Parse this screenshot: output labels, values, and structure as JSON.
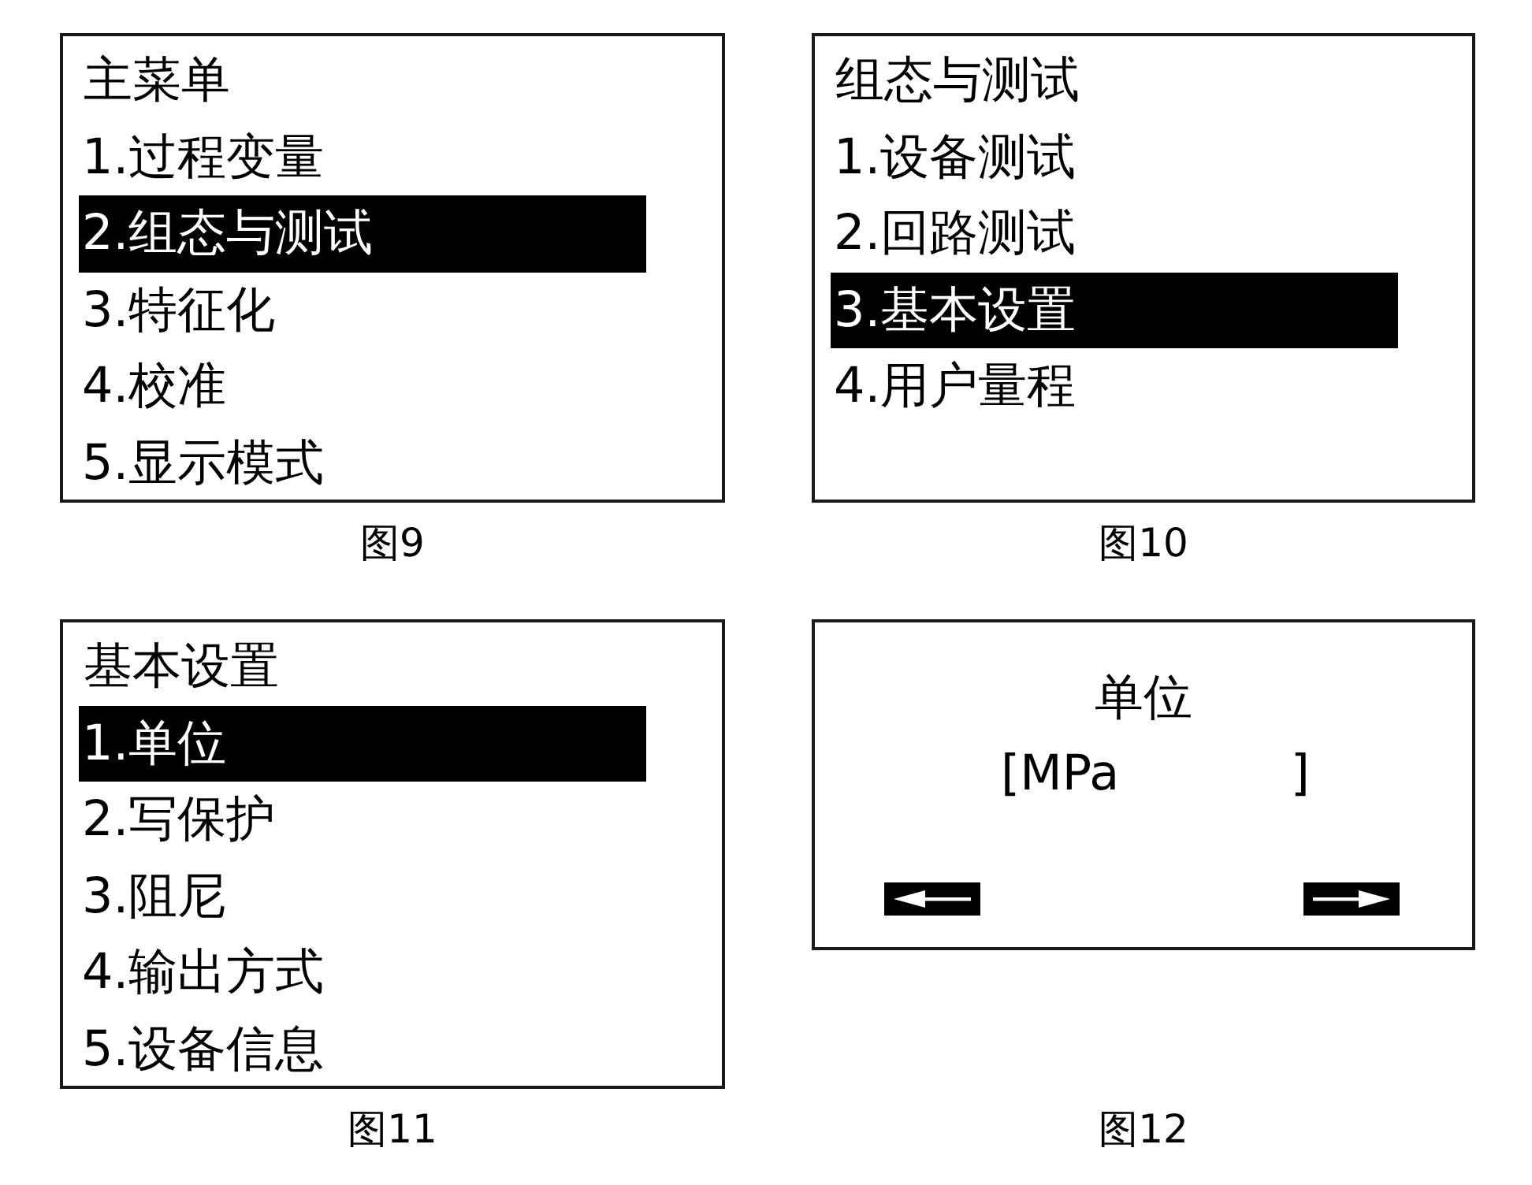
{
  "figures": [
    {
      "kind": "menu",
      "title": "主菜单",
      "items": [
        {
          "label": "1.过程变量",
          "selected": false
        },
        {
          "label": "2.组态与测试",
          "selected": true
        },
        {
          "label": "3.特征化",
          "selected": false
        },
        {
          "label": "4.校准",
          "selected": false
        },
        {
          "label": "5.显示模式",
          "selected": false
        }
      ],
      "caption": "图9"
    },
    {
      "kind": "menu",
      "title": "组态与测试",
      "items": [
        {
          "label": "1.设备测试",
          "selected": false
        },
        {
          "label": "2.回路测试",
          "selected": false
        },
        {
          "label": "3.基本设置",
          "selected": true
        },
        {
          "label": "4.用户量程",
          "selected": false
        }
      ],
      "caption": "图10"
    },
    {
      "kind": "menu",
      "title": "基本设置",
      "items": [
        {
          "label": "1.单位",
          "selected": true
        },
        {
          "label": "2.写保护",
          "selected": false
        },
        {
          "label": "3.阻尼",
          "selected": false
        },
        {
          "label": "4.输出方式",
          "selected": false
        },
        {
          "label": "5.设备信息",
          "selected": false
        }
      ],
      "caption": "图11"
    },
    {
      "kind": "entry",
      "title": "单位",
      "field": {
        "open": "[",
        "value": "MPa",
        "close": "]"
      },
      "caption": "图12"
    }
  ]
}
